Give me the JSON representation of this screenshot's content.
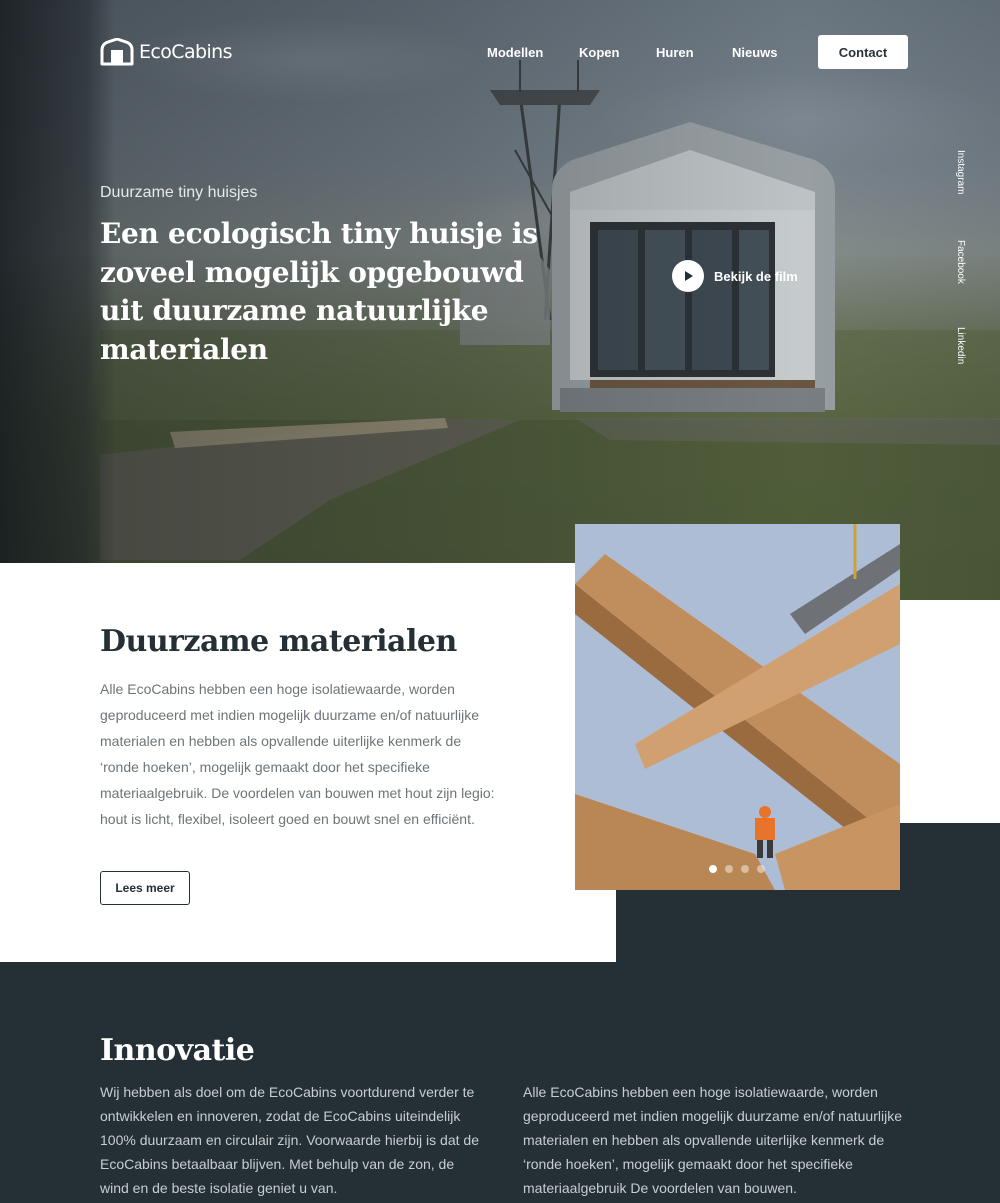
{
  "brand": {
    "name": "EcoCabins"
  },
  "nav": {
    "items": [
      "Modellen",
      "Kopen",
      "Huren",
      "Nieuws"
    ],
    "contact_label": "Contact"
  },
  "hero": {
    "kicker": "Duurzame tiny huisjes",
    "title": "Een ecologisch tiny huisje is zoveel mogelijk opgebouwd uit duurzame natuurlijke materialen",
    "video_label": "Bekijk de film"
  },
  "social": [
    "Instagram",
    "Facebook",
    "Linkedin"
  ],
  "materials": {
    "title": "Duurzame materialen",
    "body": "Alle EcoCabins hebben een hoge isolatiewaarde, worden geproduceerd met indien mogelijk duurzame en/of natuurlijke materialen en hebben als opvallende uiterlijke kenmerk de ‘ronde hoeken’, mogelijk gemaakt door het specifieke materiaalgebruik. De voordelen van bouwen met hout zijn legio: hout is licht, flexibel, isoleert goed en bouwt snel en efficiënt.",
    "read_more_label": "Lees meer",
    "carousel": {
      "slides": 4,
      "active": 1
    }
  },
  "innovation": {
    "title": "Innovatie",
    "col_left": "Wij hebben als doel om de EcoCabins voortdurend verder te ontwikkelen en innoveren, zodat de EcoCabins uiteindelijk 100% duurzaam en circulair zijn. Voorwaarde hierbij is dat de EcoCabins betaalbaar blijven. Met behulp van de zon, de wind en de beste isolatie geniet u van.",
    "col_right": "Alle EcoCabins hebben een hoge isolatiewaarde, worden geproduceerd met indien mogelijk duurzame en/of natuurlijke materialen en hebben als opvallende uiterlijke kenmerk de ‘ronde hoeken’, mogelijk gemaakt door het specifieke materiaalgebruik De voordelen van bouwen."
  },
  "colors": {
    "dark": "#243036",
    "white": "#ffffff",
    "body_text": "#6d7479",
    "accent_orange": "#e8732a"
  },
  "icons": [
    "house-logo-icon",
    "play-icon"
  ]
}
